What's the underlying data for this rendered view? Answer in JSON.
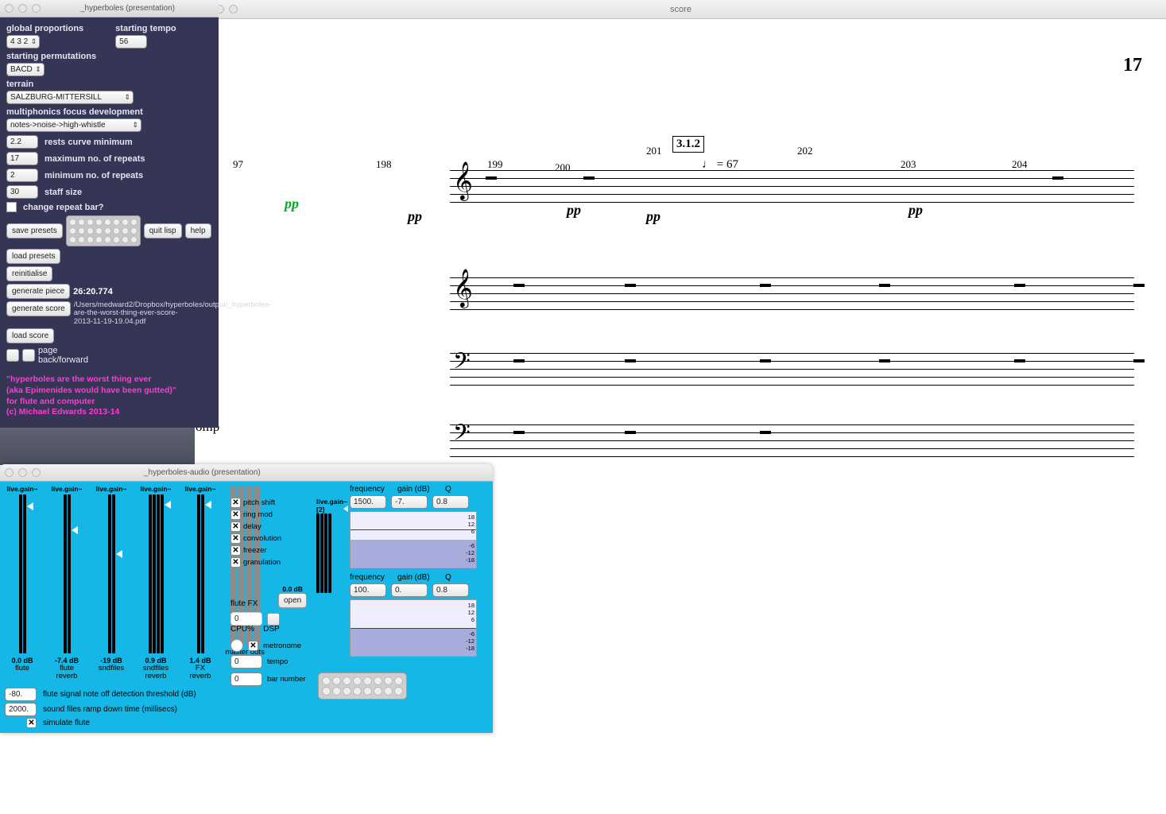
{
  "score": {
    "title": "score",
    "pageNumber": "17",
    "boxMarker": "3.1.2",
    "tempoMark": "♩ = 67",
    "labels": {
      "omp": "omp"
    },
    "measures": [
      "97",
      "198",
      "199",
      "200",
      "201",
      "202",
      "203",
      "204"
    ],
    "dynamics": [
      "pp",
      "pp",
      "pp",
      "pp",
      "pp"
    ]
  },
  "panel": {
    "title": "_hyperboles (presentation)",
    "labels": {
      "global_proportions": "global proportions",
      "starting_tempo": "starting tempo",
      "starting_permutations": "starting permutations",
      "terrain": "terrain",
      "multiphonics": "multiphonics focus development",
      "rests_curve": "rests curve minimum",
      "max_repeats": "maximum no. of repeats",
      "min_repeats": "minimum no. of repeats",
      "staff_size": "staff size",
      "change_repeat": "change repeat bar?",
      "page_back_forward": "page\nback/forward"
    },
    "values": {
      "global_proportions": "4 3 2",
      "starting_tempo": "56",
      "starting_permutations": "BACD",
      "terrain": "SALZBURG-MITTERSILL",
      "multiphonics": "notes->noise->high-whistle",
      "rests_curve": "2.2",
      "max_repeats": "17",
      "min_repeats": "2",
      "staff_size": "30"
    },
    "buttons": {
      "save_presets": "save presets",
      "load_presets": "load presets",
      "reinitialise": "reinitialise",
      "generate_piece": "generate piece",
      "generate_score": "generate score",
      "load_score": "load score",
      "quit_lisp": "quit lisp",
      "help": "help"
    },
    "gen_time": "26:20.774",
    "path": "/Users/medward2/Dropbox/hyperboles/output/_hyperboles-are-the-worst-thing-ever-score-2013-11-19-19.04.pdf",
    "credit": "\"hyperboles are the worst thing ever\n(aka Epimenides would have been gutted)\"\nfor flute and computer\n(c) Michael Edwards 2013-14"
  },
  "audio": {
    "title": "_hyperboles-audio (presentation)",
    "meters": [
      {
        "tag": "live.gain~",
        "val": "0.0 dB",
        "lbl": "flute",
        "bars": 2,
        "tri": 10
      },
      {
        "tag": "live.gain~",
        "val": "-7.4 dB",
        "lbl": "flute\nreverb",
        "bars": 2,
        "tri": 40
      },
      {
        "tag": "live.gain~",
        "val": "-19 dB",
        "lbl": "sndfiles",
        "bars": 2,
        "tri": 70
      },
      {
        "tag": "live.gain~",
        "val": "0.9 dB",
        "lbl": "sndfiles\nreverb",
        "bars": 4,
        "tri": 8
      },
      {
        "tag": "live.gain~",
        "val": "1.4 dB",
        "lbl": "FX\nreverb",
        "bars": 2,
        "tri": 8
      },
      {
        "tag": "",
        "val": "",
        "lbl": "master outs",
        "bars": 4,
        "tri": null,
        "grey": true
      }
    ],
    "mini": {
      "tag": "live.gain~[2]",
      "val": "0.0 dB"
    },
    "fx": [
      {
        "label": "pitch shift",
        "on": true
      },
      {
        "label": "ring mod",
        "on": true
      },
      {
        "label": "delay",
        "on": true
      },
      {
        "label": "convolution",
        "on": true
      },
      {
        "label": "freezer",
        "on": true
      },
      {
        "label": "granulation",
        "on": true
      }
    ],
    "fx_labels": {
      "flute_fx": "flute FX",
      "open": "open",
      "flute_fx_val": "0"
    },
    "eq": {
      "headers": {
        "freq": "frequency",
        "gain": "gain (dB)",
        "q": "Q"
      },
      "bands": [
        {
          "freq": "1500.",
          "gain": "-7.",
          "q": "0.8"
        },
        {
          "freq": "100.",
          "gain": "0.",
          "q": "0.8"
        }
      ],
      "ticks": "18\n12\n6\n\n-6\n-12\n-18"
    },
    "cpu_labels": {
      "cpu": "CPU%",
      "dsp": "DSP"
    },
    "metronome": {
      "label": "metronome"
    },
    "tempo": {
      "val": "0",
      "label": "tempo"
    },
    "bar": {
      "val": "0",
      "label": "bar number"
    },
    "bottom": {
      "thresh_val": "-80.",
      "thresh_lbl": "flute signal note off detection threshold (dB)",
      "ramp_val": "2000.",
      "ramp_lbl": "sound files ramp down time (millisecs)",
      "sim_lbl": "simulate flute"
    }
  }
}
